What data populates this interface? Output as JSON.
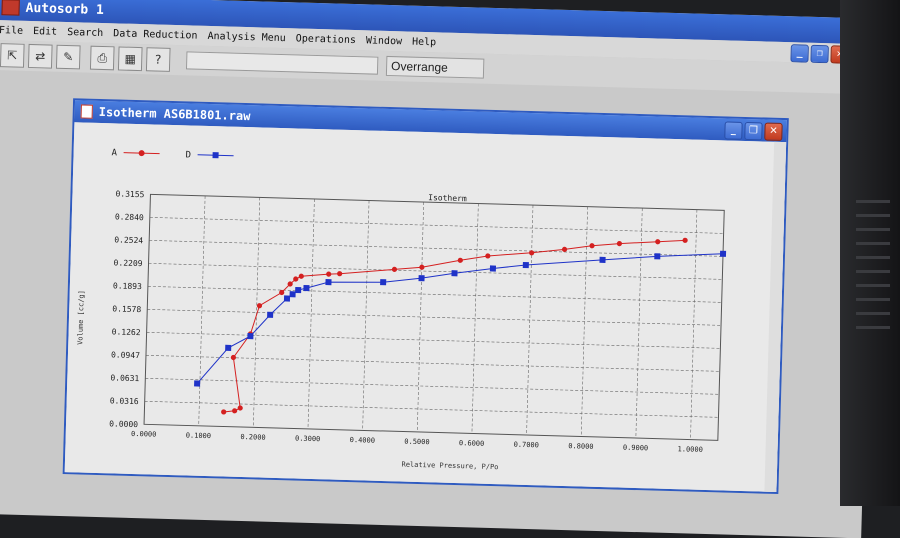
{
  "app": {
    "title": "Autosorb 1"
  },
  "menu": [
    "File",
    "Edit",
    "Search",
    "Data Reduction",
    "Analysis Menu",
    "Operations",
    "Window",
    "Help"
  ],
  "toolbar": {
    "status_text": "Overrange"
  },
  "child_window": {
    "title": "Isotherm AS6B1801.raw"
  },
  "colors": {
    "series_a": "#d42020",
    "series_d": "#1f33c8"
  },
  "chart_data": {
    "type": "line",
    "title": "Isotherm",
    "xlabel": "Relative Pressure, P/Po",
    "ylabel": "Volume [cc/g]",
    "xlim": [
      0.0,
      1.05
    ],
    "ylim": [
      0.0,
      0.3155
    ],
    "x_ticks": [
      "0.0000",
      "0.1000",
      "0.2000",
      "0.3000",
      "0.4000",
      "0.5000",
      "0.6000",
      "0.7000",
      "0.8000",
      "0.9000",
      "1.0000"
    ],
    "y_ticks": [
      "0.0000",
      "0.0316",
      "0.0631",
      "0.0947",
      "0.1262",
      "0.1578",
      "0.1893",
      "0.2209",
      "0.2524",
      "0.2840",
      "0.3155"
    ],
    "grid": true,
    "legend_position": "top-left",
    "series": [
      {
        "name": "A",
        "x": [
          0.145,
          0.165,
          0.175,
          0.16,
          0.19,
          0.205,
          0.245,
          0.26,
          0.27,
          0.28,
          0.33,
          0.35,
          0.45,
          0.5,
          0.57,
          0.62,
          0.7,
          0.76,
          0.81,
          0.86,
          0.93,
          0.98
        ],
        "y": [
          0.02,
          0.022,
          0.026,
          0.095,
          0.128,
          0.167,
          0.186,
          0.198,
          0.205,
          0.209,
          0.213,
          0.214,
          0.222,
          0.226,
          0.237,
          0.244,
          0.25,
          0.256,
          0.262,
          0.266,
          0.27,
          0.273
        ]
      },
      {
        "name": "D",
        "x": [
          0.095,
          0.15,
          0.19,
          0.225,
          0.255,
          0.265,
          0.275,
          0.29,
          0.33,
          0.43,
          0.5,
          0.56,
          0.63,
          0.69,
          0.83,
          0.93,
          1.05
        ],
        "y": [
          0.058,
          0.108,
          0.125,
          0.155,
          0.178,
          0.184,
          0.19,
          0.193,
          0.202,
          0.204,
          0.211,
          0.219,
          0.227,
          0.233,
          0.243,
          0.25,
          0.256
        ]
      }
    ]
  }
}
